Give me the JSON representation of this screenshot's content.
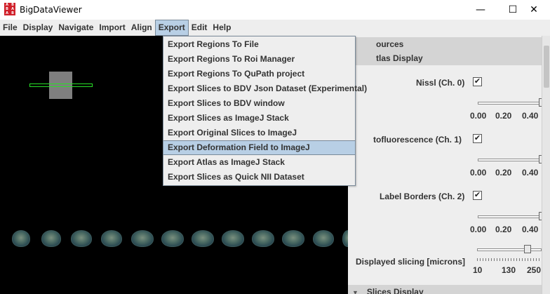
{
  "window": {
    "title": "BigDataViewer",
    "icon_letters": [
      "A",
      "B",
      "B",
      "A",
      "A",
      "B"
    ],
    "minimize_glyph": "—",
    "maximize_glyph": "☐",
    "close_glyph": "✕"
  },
  "menubar": {
    "items": [
      {
        "label": "File"
      },
      {
        "label": "Display"
      },
      {
        "label": "Navigate"
      },
      {
        "label": "Import"
      },
      {
        "label": "Align"
      },
      {
        "label": "Export"
      },
      {
        "label": "Edit"
      },
      {
        "label": "Help"
      }
    ],
    "active": "Export"
  },
  "export_menu": {
    "items": [
      {
        "label": "Export Regions To File"
      },
      {
        "label": "Export Regions To Roi Manager"
      },
      {
        "label": "Export Regions To QuPath project"
      },
      {
        "label": "Export Slices to BDV Json Dataset (Experimental)"
      },
      {
        "label": "Export Slices to BDV window"
      },
      {
        "label": "Export Slices as ImageJ Stack"
      },
      {
        "label": "Export Original Slices to ImageJ"
      },
      {
        "label": "Export Deformation Field to ImageJ"
      },
      {
        "label": "Export Atlas as ImageJ Stack"
      },
      {
        "label": "Export Slices as Quick NII Dataset"
      }
    ],
    "highlighted": "Export Deformation Field to ImageJ"
  },
  "panel": {
    "sources_header": "ources",
    "atlas_header": "tlas Display",
    "channels": [
      {
        "label": "Nissl (Ch. 0)",
        "checked": true,
        "ticks": [
          "0.00",
          "0.20",
          "0.40"
        ]
      },
      {
        "label": "tofluorescence (Ch. 1)",
        "checked": true,
        "ticks": [
          "0.00",
          "0.20",
          "0.40"
        ]
      },
      {
        "label": "Label Borders (Ch. 2)",
        "checked": true,
        "ticks": [
          "0.00",
          "0.20",
          "0.40"
        ]
      }
    ],
    "check_glyph": "✔",
    "slicing_label": "Displayed slicing [microns]",
    "slicing_ticks": [
      "10",
      "130",
      "250"
    ],
    "slices_header": "Slices Display",
    "collapse_glyph": "▼"
  },
  "colors": {
    "viewer_bg": "#000000",
    "menu_highlight": "#b8cfe5",
    "overlay_green": "#27e027",
    "panel_bg": "#eeeeee"
  }
}
